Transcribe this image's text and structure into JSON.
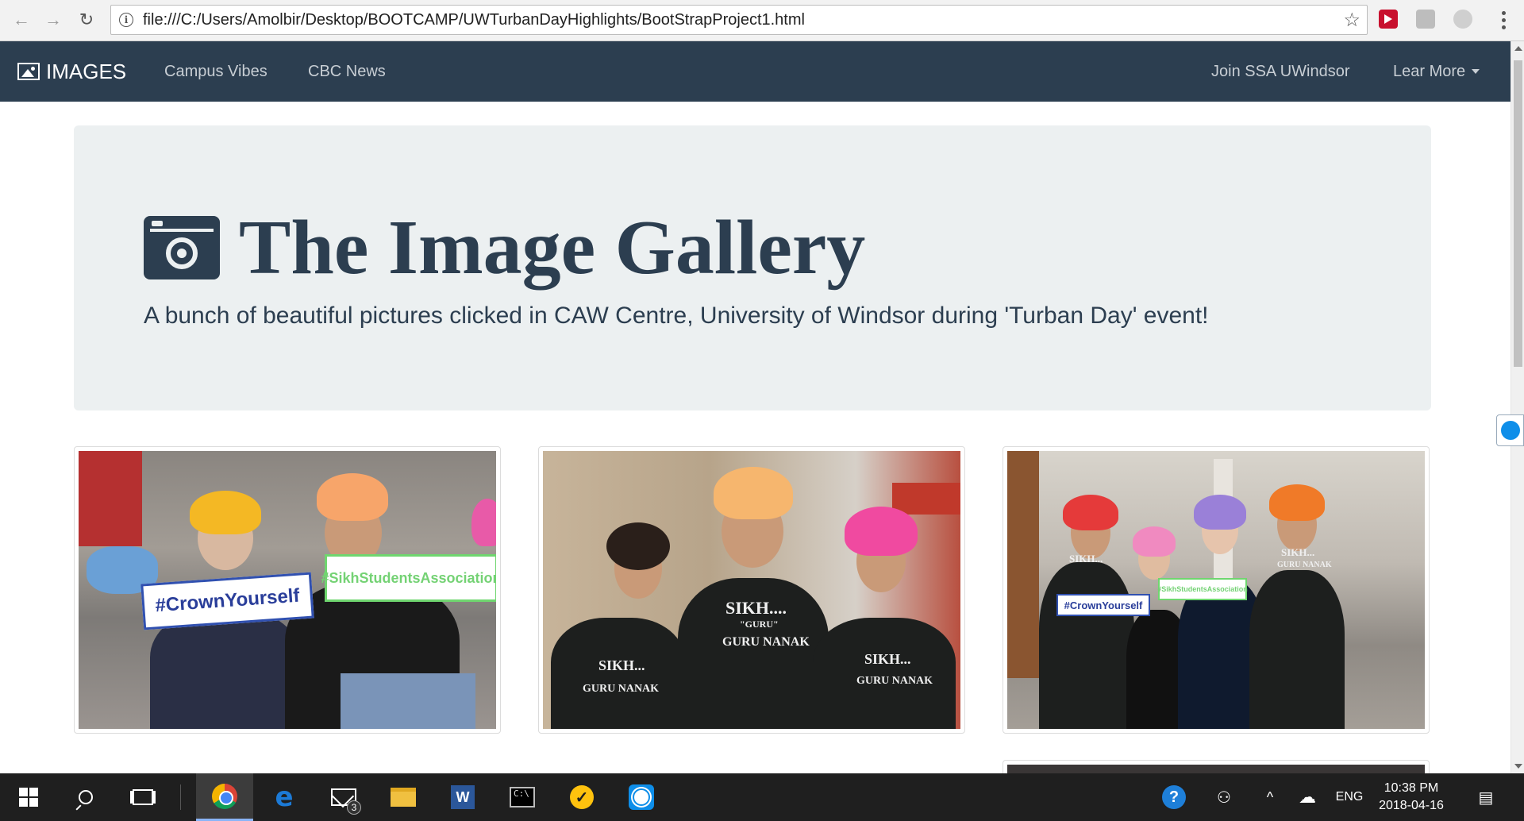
{
  "browser": {
    "url": "file:///C:/Users/Amolbir/Desktop/BOOTCAMP/UWTurbanDayHighlights/BootStrapProject1.html",
    "back_glyph": "←",
    "forward_glyph": "→",
    "reload_glyph": "↻",
    "info_glyph": "i",
    "star_glyph": "☆"
  },
  "navbar": {
    "brand": "IMAGES",
    "links": [
      "Campus Vibes",
      "CBC News"
    ],
    "right_links": [
      "Join SSA UWindsor",
      "Lear More"
    ],
    "bg_color": "#2c3e50"
  },
  "jumbotron": {
    "title": "The Image Gallery",
    "lead": "A bunch of beautiful pictures clicked in CAW Centre, University of Windsor during 'Turban Day' event!"
  },
  "gallery": {
    "photo1": {
      "sign_blue": "#CrownYourself",
      "sign_green": "#SikhStudentsAssociation"
    },
    "photo2": {
      "shirt_left": "SIKH...",
      "shirt_left_2": "GURU NANAK",
      "shirt_center": "SIKH....",
      "shirt_center_sub": "\"GURU\"",
      "shirt_center_2": "GURU NANAK",
      "shirt_right": "SIKH...",
      "shirt_right_2": "GURU NANAK"
    },
    "photo3": {
      "sign_blue": "#CrownYourself",
      "sign_green": "#SikhStudentsAssociation",
      "shirt_left": "SIKH...",
      "shirt_right": "SIKH...",
      "shirt_right_2": "GURU NANAK"
    }
  },
  "taskbar": {
    "mail_badge": "3",
    "word_letter": "W",
    "cmd_prompt": "C:\\",
    "norton_glyph": "✓",
    "edge_glyph": "e",
    "help_glyph": "?",
    "people_glyph": "⚇",
    "chevron_glyph": "^",
    "cloud_glyph": "☁",
    "lang": "ENG",
    "time": "10:38 PM",
    "date": "2018-04-16",
    "notify_glyph": "▤"
  }
}
